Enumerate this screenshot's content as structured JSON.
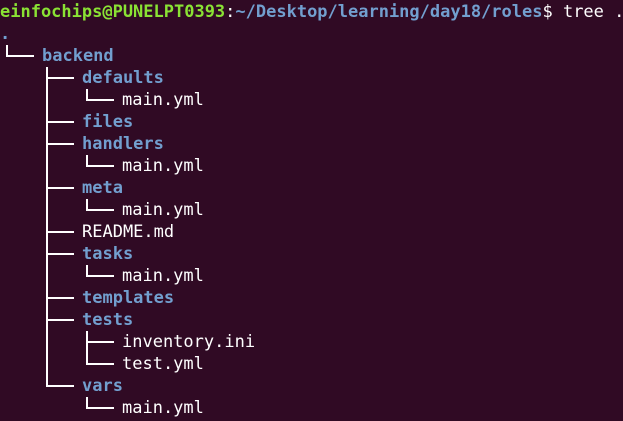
{
  "prompt": {
    "user_host": "einfochips@PUNELPT0393",
    "colon": ":",
    "cwd": "~/Desktop/learning/day18/roles",
    "symbol": "$",
    "command": " tree ."
  },
  "tree": {
    "root": ".",
    "entries": [
      {
        "name": "backend",
        "type": "dir"
      },
      {
        "name": "defaults",
        "type": "dir"
      },
      {
        "name": "main.yml",
        "type": "file"
      },
      {
        "name": "files",
        "type": "dir"
      },
      {
        "name": "handlers",
        "type": "dir"
      },
      {
        "name": "main.yml",
        "type": "file"
      },
      {
        "name": "meta",
        "type": "dir"
      },
      {
        "name": "main.yml",
        "type": "file"
      },
      {
        "name": "README.md",
        "type": "file"
      },
      {
        "name": "tasks",
        "type": "dir"
      },
      {
        "name": "main.yml",
        "type": "file"
      },
      {
        "name": "templates",
        "type": "dir"
      },
      {
        "name": "tests",
        "type": "dir"
      },
      {
        "name": "inventory.ini",
        "type": "file"
      },
      {
        "name": "test.yml",
        "type": "file"
      },
      {
        "name": "vars",
        "type": "dir"
      },
      {
        "name": "main.yml",
        "type": "file"
      }
    ]
  },
  "colors": {
    "background": "#300a24",
    "user_host": "#8ae234",
    "path": "#729fcf",
    "directory": "#729fcf",
    "text": "#ffffff"
  }
}
